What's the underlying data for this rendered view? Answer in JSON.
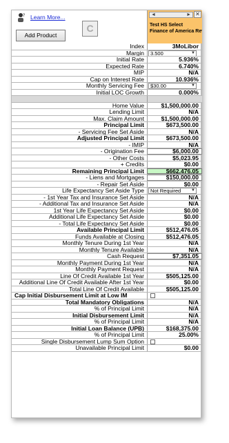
{
  "header": {
    "learn_more": "Learn More...",
    "add_product": "Add Product",
    "c_button": "C",
    "product_name_line1": "Test HS Select",
    "product_name_line2": "Finance of America Revers",
    "nav_left": "◄",
    "nav_right": "►",
    "close": "✕"
  },
  "rows": [
    {
      "label": "Index",
      "value": "3MoLibor"
    },
    {
      "label": "Margin",
      "value": "3.500",
      "type": "dropdown"
    },
    {
      "label": "Initial Rate",
      "value": "5.936%"
    },
    {
      "label": "Expected Rate",
      "value": "6.740%"
    },
    {
      "label": "MIP",
      "value": "N/A"
    },
    {
      "label": "Cap on Interest Rate",
      "value": "10.936%"
    },
    {
      "label": "Monthly Servicing Fee",
      "value": "$30.00",
      "type": "dropdown"
    },
    {
      "label": "Initial LOC Growth",
      "value": "0.000%"
    },
    {
      "label": "",
      "value": "",
      "type": "gray"
    },
    {
      "label": "Home Value",
      "value": "$1,500,000.00"
    },
    {
      "label": "Lending Limit",
      "value": "N/A"
    },
    {
      "label": "Max. Claim Amount",
      "value": "$1,500,000.00"
    },
    {
      "label": "Principal Limit",
      "value": "$673,500.00",
      "bold": true
    },
    {
      "label": "- Servicing Fee Set Aside",
      "value": "N/A"
    },
    {
      "label": "Adjusted Principal Limit",
      "value": "$673,500.00",
      "bold": true
    },
    {
      "label": "- IMIP",
      "value": "N/A"
    },
    {
      "label": "- Origination Fee",
      "value": "$6,000.00",
      "type": "box"
    },
    {
      "label": "- Other Costs",
      "value": "$5,023.95"
    },
    {
      "label": "+ Credits",
      "value": "$0.00"
    },
    {
      "label": "Remaining Principal Limit",
      "value": "$662,476.05",
      "bold": true,
      "type": "green"
    },
    {
      "label": "- Liens and Mortgages",
      "value": "$150,000.00",
      "type": "box"
    },
    {
      "label": "- Repair Set Aside",
      "value": "$0.00"
    },
    {
      "label": "Life Expectancy Set Aside Type",
      "value": "Not Required",
      "type": "dropdown"
    },
    {
      "label": "- 1st Year Tax and Insurance Set Aside",
      "value": "N/A"
    },
    {
      "label": "- Additional Tax and Insurance Set Aside",
      "value": "N/A"
    },
    {
      "label": "1st Year Life Expectancy Set Aside",
      "value": "$0.00"
    },
    {
      "label": "Additional Life Expectancy Set Aside",
      "value": "$0.00"
    },
    {
      "label": "- Total Life Expectancy Set Aside",
      "value": "$0.00"
    },
    {
      "label": "Available Principal Limit",
      "value": "$512,476.05",
      "bold": true
    },
    {
      "label": "Funds Available at Closing",
      "value": "$512,476.05"
    },
    {
      "label": "Monthly Tenure During 1st Year",
      "value": "N/A"
    },
    {
      "label": "Monthly Tenure Available",
      "value": "N/A"
    },
    {
      "label": "Cash Request",
      "value": "$7,351.05",
      "type": "box"
    },
    {
      "label": "Monthly Payment During 1st Year",
      "value": "N/A"
    },
    {
      "label": "Monthly Payment Request",
      "value": "N/A"
    },
    {
      "label": "Line Of Credit Available 1st Year",
      "value": "$505,125.00"
    },
    {
      "label": "Additional Line Of Credit Available After 1st Year",
      "value": "$0.00"
    },
    {
      "label": "Total Line Of Credit Available",
      "value": "$505,125.00"
    },
    {
      "label": "Cap Initial Disbursement Limit at Low IM",
      "value": "",
      "bold": true,
      "left": true,
      "type": "checkbox"
    },
    {
      "label": "Total Mandatory Obligations",
      "value": "N/A",
      "bold": true
    },
    {
      "label": "% of Principal Limit",
      "value": "N/A"
    },
    {
      "label": "Initial Disbursement Limit",
      "value": "N/A",
      "bold": true
    },
    {
      "label": "% of Principal Limit",
      "value": "N/A"
    },
    {
      "label": "Initial Loan Balance (UPB)",
      "value": "$168,375.00",
      "bold": true
    },
    {
      "label": "% of Principal Limit",
      "value": "25.00%"
    },
    {
      "label": "Single Disbursement Lump Sum Option",
      "value": "",
      "type": "checkbox"
    },
    {
      "label": "Unavailable Principal Limit",
      "value": "$0.00"
    }
  ]
}
